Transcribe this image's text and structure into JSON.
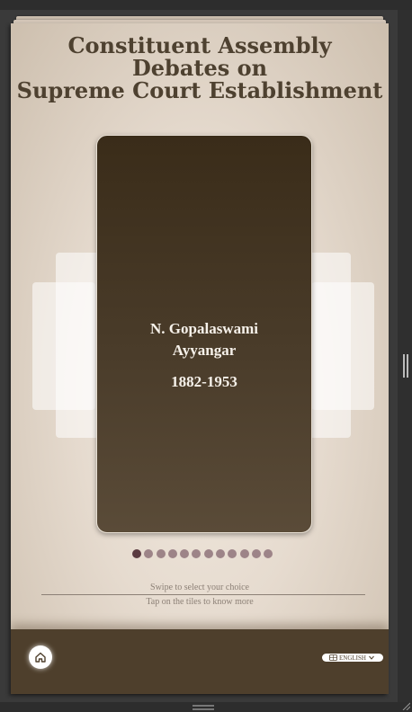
{
  "title": {
    "line1": "Constituent Assembly",
    "line2": "Debates on",
    "line3": "Supreme Court Establishment"
  },
  "carousel": {
    "active_card": {
      "name_line1": "N. Gopalaswami",
      "name_line2": "Ayyangar",
      "years": "1882-1953"
    },
    "total_items": 12,
    "active_index": 0
  },
  "hints": {
    "swipe": "Swipe to select your choice",
    "tap": "Tap on the tiles to know more"
  },
  "footer": {
    "home_icon": "home-icon",
    "language": "ENGLISH",
    "language_icon": "globe-icon"
  },
  "colors": {
    "title": "#4e4130",
    "card_bg": "#3a2c19",
    "footer_bg": "#4e3f2c",
    "dot_active": "#5a3a40",
    "dot_inactive": "#9d8488"
  }
}
